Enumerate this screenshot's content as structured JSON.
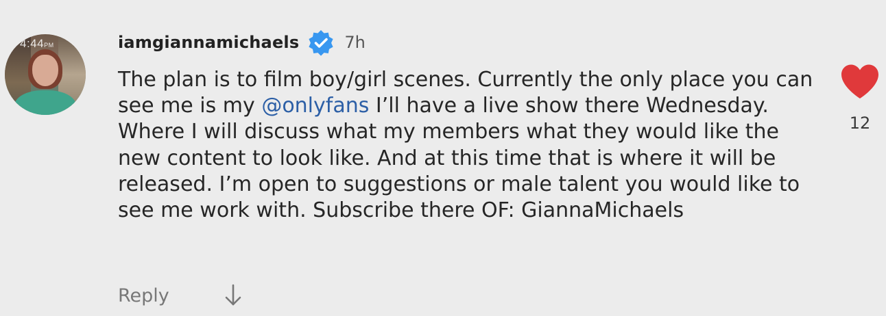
{
  "comment": {
    "avatar_overlay": {
      "time": "4:44",
      "period": "PM"
    },
    "username": "iamgiannamichaels",
    "verified_icon": "verified-badge-icon",
    "timestamp": "7h",
    "text_before_mention": "The plan is to film boy/girl scenes. Currently the only place you can see me is my ",
    "mention": "@onlyfans",
    "text_after_mention": " I’ll have a live show there Wednesday. Where I will discuss what my members what they would like the new content to look like. And at this time that is where it will be released. I’m open to suggestions or male talent you would like to see me work with. Subscribe there OF: GiannaMichaels",
    "like": {
      "icon": "heart-icon",
      "liked": true,
      "count": "12",
      "color": "#e0393b"
    },
    "reply_label": "Reply",
    "expand_icon": "arrow-down-icon"
  },
  "colors": {
    "background": "#ececec",
    "mention": "#2c5fa6",
    "verified": "#3897f0"
  }
}
